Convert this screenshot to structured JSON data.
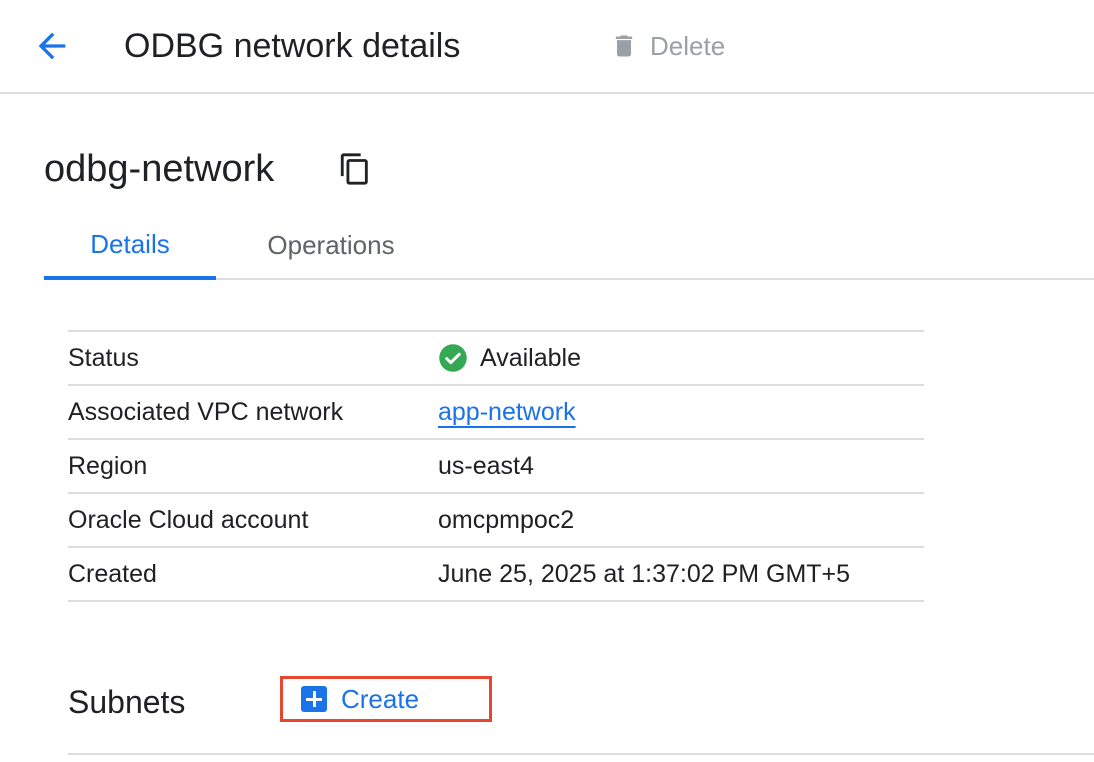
{
  "header": {
    "back_icon": "arrow-back-icon",
    "title": "ODBG network details",
    "delete_label": "Delete",
    "delete_icon": "trash-icon",
    "delete_disabled": true
  },
  "resource": {
    "name": "odbg-network",
    "copy_icon": "copy-icon"
  },
  "tabs": [
    {
      "label": "Details",
      "active": true
    },
    {
      "label": "Operations",
      "active": false
    }
  ],
  "details": {
    "rows": [
      {
        "key": "Status",
        "value": "Available",
        "icon": "check-circle-icon"
      },
      {
        "key": "Associated VPC network",
        "value": "app-network",
        "link": true
      },
      {
        "key": "Region",
        "value": "us-east4"
      },
      {
        "key": "Oracle Cloud account",
        "value": "omcpmpoc2"
      },
      {
        "key": "Created",
        "value": "June 25, 2025 at 1:37:02 PM GMT+5"
      }
    ]
  },
  "subnets": {
    "title": "Subnets",
    "create_label": "Create",
    "create_icon": "add-box-icon"
  },
  "colors": {
    "accent": "#1a73e8",
    "success": "#34a853",
    "highlight_border": "#e8472f",
    "disabled": "#9aa0a6",
    "divider": "#dadce0"
  }
}
